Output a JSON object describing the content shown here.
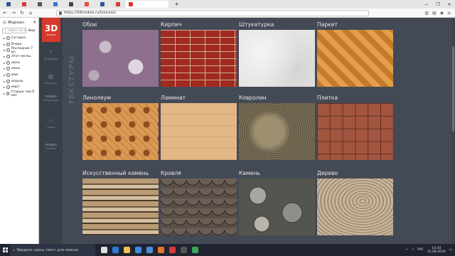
{
  "browser": {
    "url": "https://3dmodels.ru/textures/",
    "tab_title": "",
    "window_controls": [
      "—",
      "❐",
      "✕"
    ],
    "toolbar_icons": [
      "library-icon",
      "reader-icon",
      "account-icon",
      "menu-icon"
    ]
  },
  "sidebar": {
    "title": "Журнал",
    "search_placeholder": "Поиск по журн",
    "view_label": "Вид",
    "items": [
      {
        "label": "Сегодня"
      },
      {
        "label": "Вчера"
      },
      {
        "label": "Последние 7 дн"
      },
      {
        "label": "Этот месяц"
      },
      {
        "label": "июль"
      },
      {
        "label": "июнь"
      },
      {
        "label": "май"
      },
      {
        "label": "апрель"
      },
      {
        "label": "март"
      },
      {
        "label": "Старше чем 6 мес"
      }
    ]
  },
  "site": {
    "logo_text": "3D",
    "logo_sub": "MODELS",
    "section_title": "ТЕКСТУРЫ",
    "nav": [
      {
        "label": "3D модели",
        "icon": "model-icon"
      },
      {
        "label": "текстуры",
        "icon": "texture-icon"
      },
      {
        "label": "литература",
        "icon": "book-icon"
      },
      {
        "label": "уроки",
        "icon": "lesson-icon"
      },
      {
        "label": "галерея",
        "icon": "gallery-icon"
      }
    ],
    "nav_brand_text": [
      "скоро",
      "скоро"
    ]
  },
  "textures": [
    {
      "label": "Обои",
      "pattern": "wallpaper"
    },
    {
      "label": "Кирпич",
      "pattern": "brick"
    },
    {
      "label": "Штукатурка",
      "pattern": "plaster"
    },
    {
      "label": "Паркет",
      "pattern": "parquet"
    },
    {
      "label": "Линолеум",
      "pattern": "linoleum"
    },
    {
      "label": "Ламинат",
      "pattern": "laminate"
    },
    {
      "label": "Ковролин",
      "pattern": "carpet"
    },
    {
      "label": "Плитка",
      "pattern": "tile"
    },
    {
      "label": "Искусственный камень",
      "pattern": "fakestone"
    },
    {
      "label": "Кровля",
      "pattern": "roof"
    },
    {
      "label": "Камень",
      "pattern": "stone"
    },
    {
      "label": "Дерево",
      "pattern": "wood"
    }
  ],
  "taskbar": {
    "search_text": "Введите здесь текст для поиска",
    "lang": "РУС",
    "time": "14:30",
    "date": "15.08.2020",
    "apps": [
      {
        "name": "task-view-icon",
        "color": "#dddddd"
      },
      {
        "name": "edge-icon",
        "color": "#2b7bd6"
      },
      {
        "name": "explorer-icon",
        "color": "#f2c14e"
      },
      {
        "name": "store-icon",
        "color": "#3c8ce7"
      },
      {
        "name": "mail-icon",
        "color": "#4a90d9"
      },
      {
        "name": "firefox-icon",
        "color": "#e8742a"
      },
      {
        "name": "opera-icon",
        "color": "#d63c3c"
      },
      {
        "name": "terminal-icon",
        "color": "#555555"
      },
      {
        "name": "chrome-icon",
        "color": "#3ba55d"
      }
    ]
  }
}
